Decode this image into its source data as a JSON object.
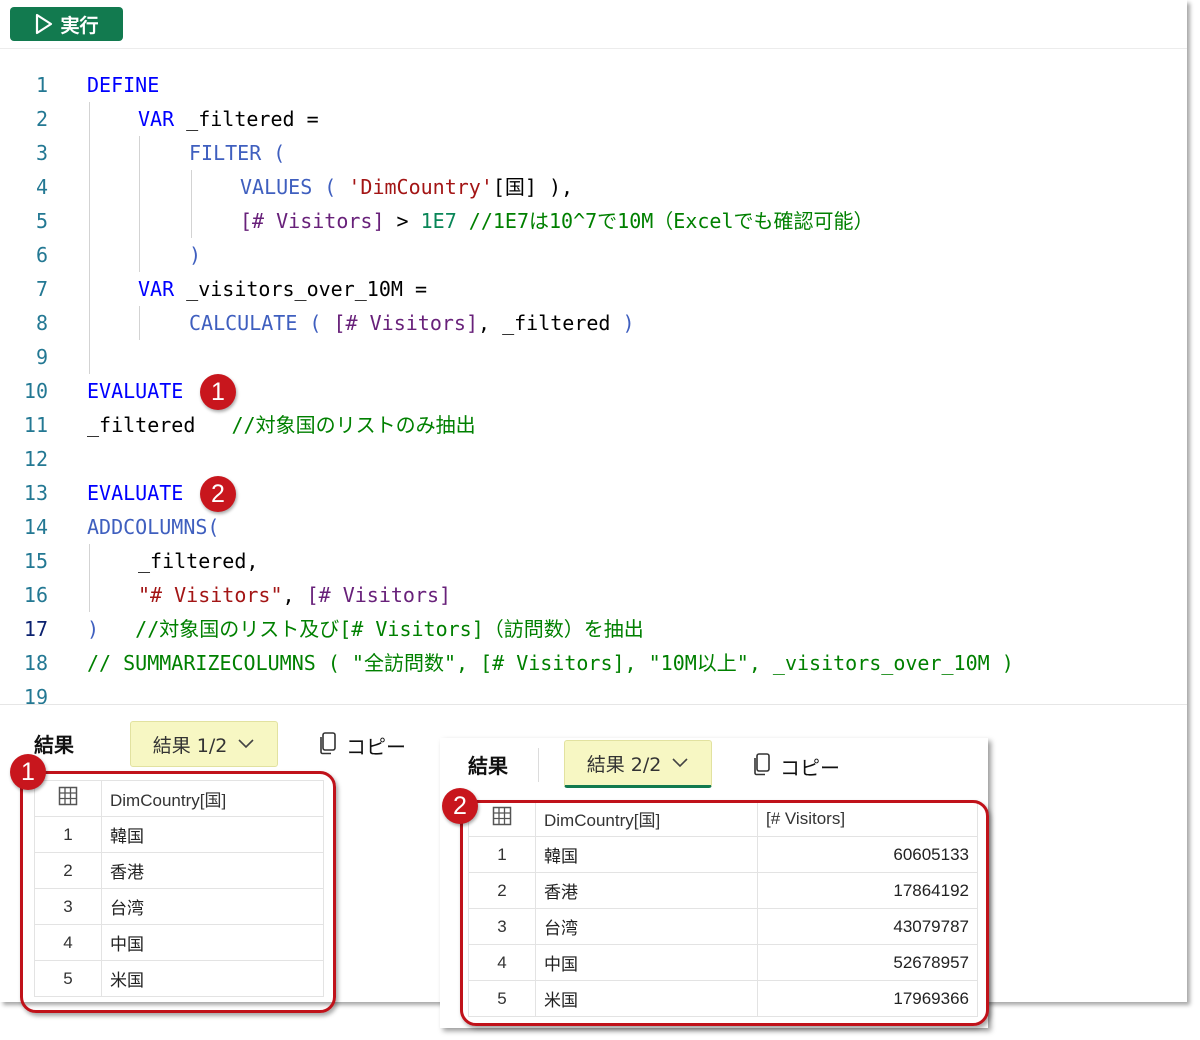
{
  "toolbar": {
    "run_label": "実行"
  },
  "code": {
    "lines": [
      {
        "n": "1",
        "parts": [
          [
            "kw",
            "DEFINE"
          ]
        ]
      },
      {
        "n": "2",
        "parts": [
          [
            "kw",
            "VAR"
          ],
          [
            "id",
            " _filtered ="
          ]
        ]
      },
      {
        "n": "3",
        "parts": [
          [
            "fn",
            "FILTER ("
          ]
        ]
      },
      {
        "n": "4",
        "parts": [
          [
            "fn",
            "VALUES ( "
          ],
          [
            "st",
            "'DimCountry'"
          ],
          [
            "id",
            "[国] ),"
          ]
        ]
      },
      {
        "n": "5",
        "parts": [
          [
            "ms",
            "[# Visitors]"
          ],
          [
            "id",
            " > "
          ],
          [
            "num",
            "1E7"
          ],
          [
            "cm",
            " //1E7は10^7で10M（Excelでも確認可能）"
          ]
        ]
      },
      {
        "n": "6",
        "parts": [
          [
            "fn",
            ")"
          ]
        ]
      },
      {
        "n": "7",
        "parts": [
          [
            "kw",
            "VAR"
          ],
          [
            "id",
            " _visitors_over_10M ="
          ]
        ]
      },
      {
        "n": "8",
        "parts": [
          [
            "fn",
            "CALCULATE ( "
          ],
          [
            "ms",
            "[# Visitors]"
          ],
          [
            "id",
            ", _filtered "
          ],
          [
            "fn",
            ")"
          ]
        ]
      },
      {
        "n": "9",
        "parts": []
      },
      {
        "n": "10",
        "parts": [
          [
            "kw",
            "EVALUATE"
          ]
        ]
      },
      {
        "n": "11",
        "parts": [
          [
            "id",
            "_filtered   "
          ],
          [
            "cm",
            "//対象国のリストのみ抽出"
          ]
        ]
      },
      {
        "n": "12",
        "parts": []
      },
      {
        "n": "13",
        "parts": [
          [
            "kw",
            "EVALUATE"
          ]
        ]
      },
      {
        "n": "14",
        "parts": [
          [
            "fn",
            "ADDCOLUMNS("
          ]
        ]
      },
      {
        "n": "15",
        "parts": [
          [
            "id",
            "_filtered,"
          ]
        ]
      },
      {
        "n": "16",
        "parts": [
          [
            "st",
            "\"# Visitors\""
          ],
          [
            "id",
            ", "
          ],
          [
            "ms",
            "[# Visitors]"
          ]
        ]
      },
      {
        "n": "17",
        "parts": [
          [
            "fn",
            ")"
          ],
          [
            "cm",
            "   //対象国のリスト及び[# Visitors]（訪問数）を抽出"
          ]
        ]
      },
      {
        "n": "18",
        "parts": [
          [
            "cm",
            "// SUMMARIZECOLUMNS ( \"全訪問数\", [# Visitors], \"10M以上\", _visitors_over_10M )"
          ]
        ]
      },
      {
        "n": "19",
        "parts": []
      }
    ]
  },
  "markers": [
    "1",
    "2"
  ],
  "results1": {
    "heading": "結果",
    "dropdown": "結果 1/2",
    "copy": "コピー",
    "columns": [
      "DimCountry[国]"
    ],
    "rows": [
      {
        "n": "1",
        "country": "韓国"
      },
      {
        "n": "2",
        "country": "香港"
      },
      {
        "n": "3",
        "country": "台湾"
      },
      {
        "n": "4",
        "country": "中国"
      },
      {
        "n": "5",
        "country": "米国"
      }
    ]
  },
  "results2": {
    "heading": "結果",
    "dropdown": "結果 2/2",
    "copy": "コピー",
    "columns": [
      "DimCountry[国]",
      "[# Visitors]"
    ],
    "rows": [
      {
        "n": "1",
        "country": "韓国",
        "visitors": "60605133"
      },
      {
        "n": "2",
        "country": "香港",
        "visitors": "17864192"
      },
      {
        "n": "3",
        "country": "台湾",
        "visitors": "43079787"
      },
      {
        "n": "4",
        "country": "中国",
        "visitors": "52678957"
      },
      {
        "n": "5",
        "country": "米国",
        "visitors": "17969366"
      }
    ]
  }
}
